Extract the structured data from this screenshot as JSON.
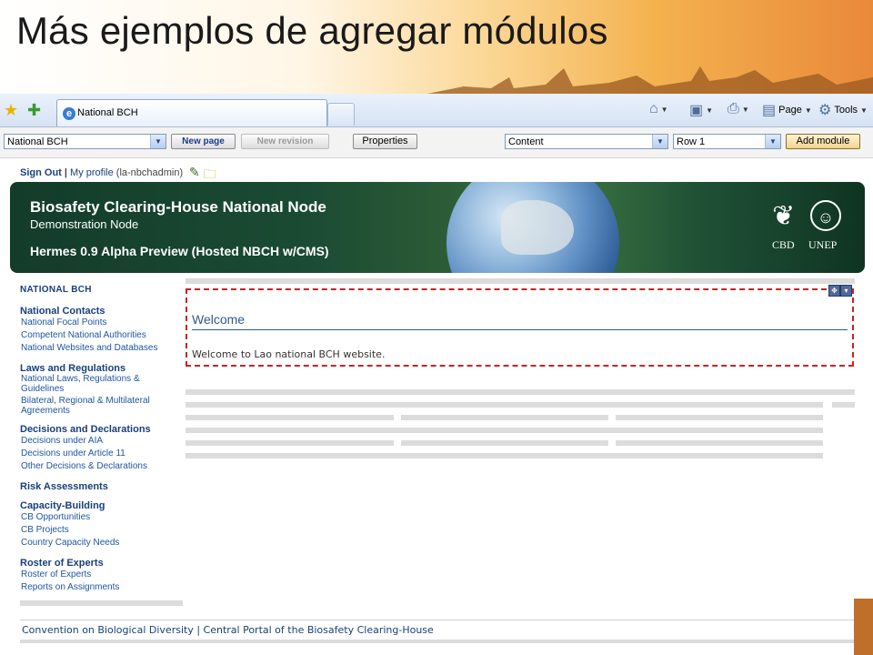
{
  "slide": {
    "title": "Más ejemplos de agregar módulos"
  },
  "browser": {
    "tab_title": "National BCH",
    "commands": {
      "page": "Page",
      "tools": "Tools"
    }
  },
  "cms_toolbar": {
    "page_select": "National BCH",
    "new_page": "New page",
    "new_revision": "New revision",
    "properties": "Properties",
    "content_select": "Content",
    "row_select": "Row 1",
    "add_module": "Add module"
  },
  "userbar": {
    "sign_out": "Sign Out",
    "separator": "|",
    "my_profile": "My profile",
    "username": "(la-nbchadmin)"
  },
  "banner": {
    "title": "Biosafety Clearing-House National Node",
    "subtitle": "Demonstration Node",
    "subtitle2": "Hermes 0.9 Alpha Preview (Hosted NBCH w/CMS)",
    "logo_left": "CBD",
    "logo_right": "UNEP"
  },
  "nav": {
    "heading": "NATIONAL BCH",
    "sections": [
      {
        "title": "National Contacts",
        "links": [
          "National Focal Points",
          "Competent National Authorities",
          "National Websites and Databases"
        ]
      },
      {
        "title": "Laws and Regulations",
        "links": [
          "National Laws, Regulations & Guidelines",
          "Bilateral, Regional & Multilateral Agreements"
        ]
      },
      {
        "title": "Decisions and Declarations",
        "links": [
          "Decisions under AIA",
          "Decisions under Article 11",
          "Other Decisions & Declarations"
        ]
      },
      {
        "title": "Risk Assessments",
        "links": []
      },
      {
        "title": "Capacity-Building",
        "links": [
          "CB Opportunities",
          "CB Projects",
          "Country Capacity Needs"
        ]
      },
      {
        "title": "Roster of Experts",
        "links": [
          "Roster of Experts",
          "Reports on Assignments"
        ]
      }
    ]
  },
  "module": {
    "title": "Welcome",
    "text": "Welcome to Lao national BCH website."
  },
  "footer": {
    "text": "Convention on Biological Diversity | Central Portal of the Biosafety Clearing-House"
  },
  "colors": {
    "accent_red": "#cc2222",
    "link_blue": "#1e56a0",
    "banner_green": "#1b4b33"
  }
}
